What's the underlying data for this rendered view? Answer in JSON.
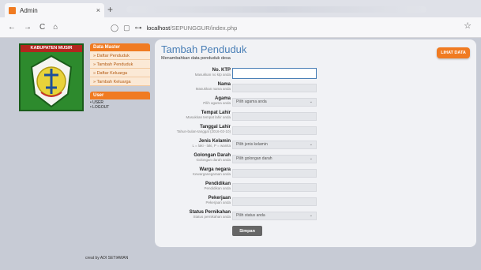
{
  "browser": {
    "tab_title": "Admin",
    "tab_close": "×",
    "new_tab": "+",
    "nav": {
      "back": "←",
      "forward": "→",
      "reload": "C",
      "home": "⌂"
    },
    "url_host": "localhost",
    "url_path": "/SEPUNGGUR/index.php",
    "star": "☆"
  },
  "logo": {
    "title": "KABUPATEN MUSIR"
  },
  "sidebar": {
    "master_head": "Data Master",
    "items": [
      {
        "label": "» Daftar Penduduk"
      },
      {
        "label": "» Tambah Penduduk"
      },
      {
        "label": "» Daftar Keluarga"
      },
      {
        "label": "» Tambah Keluarga"
      }
    ],
    "user_head": "User",
    "user_links": [
      {
        "label": "• USER"
      },
      {
        "label": "• LOGOUT"
      }
    ]
  },
  "main": {
    "title": "Tambah Penduduk",
    "subtitle": "Menambahkan data penduduk desa",
    "lihat_data": "LIHAT DATA",
    "fields": [
      {
        "label": "No. KTP",
        "hint": "Masukkan no ktp anda",
        "value": "",
        "type": "text"
      },
      {
        "label": "Nama",
        "hint": "Masukkan nama anda",
        "value": "",
        "type": "text"
      },
      {
        "label": "Agama",
        "hint": "Pilih agama anda",
        "value": "Pilih agama anda",
        "type": "select"
      },
      {
        "label": "Tempat Lahir",
        "hint": "Masukkan tempat lahir anda",
        "value": "",
        "type": "text"
      },
      {
        "label": "Tanggal Lahir",
        "hint": "Tahun-bulan-tanggal (2016-02-10)",
        "value": "",
        "type": "text"
      },
      {
        "label": "Jenis Kelamin",
        "hint": "L = laki - laki, P = wanita",
        "value": "Pilih jenis kelamin",
        "type": "select"
      },
      {
        "label": "Golongan Darah",
        "hint": "Golongan darah anda",
        "value": "Pilih golongan darah",
        "type": "select"
      },
      {
        "label": "Warga negara",
        "hint": "Kewarganegaraan anda",
        "value": "",
        "type": "text"
      },
      {
        "label": "Pendidikan",
        "hint": "Pendidikan anda",
        "value": "",
        "type": "text"
      },
      {
        "label": "Pekerjaan",
        "hint": "Pekerjaan anda",
        "value": "",
        "type": "text"
      },
      {
        "label": "Status Pernikahan",
        "hint": "Status pernikahan anda",
        "value": "Pilih status anda",
        "type": "select"
      }
    ],
    "submit": "Simpan",
    "select_arrow": "⌄"
  },
  "footer": "creat by ADI SETIAWAN",
  "colors": {
    "accent": "#f07b22",
    "title_blue": "#4a7fb6"
  }
}
